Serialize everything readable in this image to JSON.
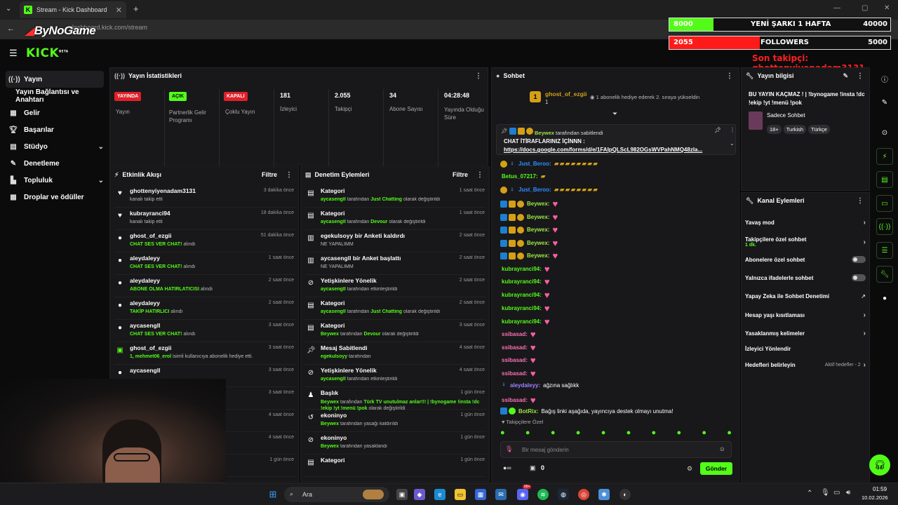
{
  "browser": {
    "tab_title": "Stream - Kick Dashboard",
    "url": "dashboard.kick.com/stream",
    "brand_overlay": "ByNoGame"
  },
  "overlay": {
    "goal1": {
      "current": "8000",
      "label": "YENİ ŞARKI 1 HAFTA",
      "target": "40000",
      "progress": 0.2,
      "color": "#53fc18"
    },
    "goal2": {
      "current": "2055",
      "label": "FOLLOWERS",
      "target": "5000",
      "progress": 0.41,
      "color": "#ff1a1a"
    },
    "last_follower": "Son takipçi: ghottenyiyenadam3131"
  },
  "kick": {
    "logo": "KICK",
    "beta": "BETA"
  },
  "sidebar": {
    "items": [
      {
        "label": "Yayın",
        "icon": "broadcast-icon"
      },
      {
        "label": "Yayın Bağlantısı ve Anahtarı",
        "icon": ""
      },
      {
        "label": "Gelir",
        "icon": "income-icon"
      },
      {
        "label": "Başarılar",
        "icon": "trophy-icon"
      },
      {
        "label": "Stüdyo",
        "icon": "studio-icon"
      },
      {
        "label": "Denetleme",
        "icon": "moderation-icon"
      },
      {
        "label": "Topluluk",
        "icon": "community-icon"
      },
      {
        "label": "Droplar ve ödüller",
        "icon": "drops-icon"
      }
    ]
  },
  "stats": {
    "title": "Yayın İstatistikleri",
    "cells": [
      {
        "badge": "YAYINDA",
        "badge_color": "#e0202a",
        "label": "Yayın"
      },
      {
        "badge": "AÇIK",
        "badge_color": "#53fc18",
        "label": "Partnerlik Gelir Programı"
      },
      {
        "badge": "KAPALI",
        "badge_color": "#e0202a",
        "label": "Çoklu Yayın"
      },
      {
        "value": "181",
        "label": "İzleyici"
      },
      {
        "value": "2.055",
        "label": "Takipçi"
      },
      {
        "value": "34",
        "label": "Abone Sayısı"
      },
      {
        "value": "04:28:48",
        "label": "Yayında Olduğu Süre"
      }
    ]
  },
  "activity": {
    "title": "Etkinlik Akışı",
    "filter": "Filtre",
    "rows": [
      {
        "name": "ghottenyiyenadam3131",
        "desc": "kanalı takip etti",
        "hl": "",
        "time": "3 dakika önce",
        "icon": "heart-icon"
      },
      {
        "name": "kubrayranci94",
        "desc": "kanalı takip etti",
        "hl": "",
        "time": "18 dakika önce",
        "icon": "heart-icon"
      },
      {
        "name": "ghost_of_ezgii",
        "hl": "CHAT SES VER CHAT!",
        "desc": "alındı",
        "time": "51 dakika önce",
        "icon": "points-icon"
      },
      {
        "name": "aleydaleyy",
        "hl": "CHAT SES VER CHAT!",
        "desc": "alındı",
        "time": "1 saat önce",
        "icon": "points-icon"
      },
      {
        "name": "aleydaleyy",
        "hl": "ABONE OLMA HATIRLATICISI",
        "desc": "alındı",
        "time": "2 saat önce",
        "icon": "points-icon"
      },
      {
        "name": "aleydaleyy",
        "hl": "TAKİP HATIRLICI",
        "desc": "alındı",
        "time": "2 saat önce",
        "icon": "points-icon"
      },
      {
        "name": "aycasengll",
        "hl": "CHAT SES VER CHAT!",
        "desc": "alındı",
        "time": "3 saat önce",
        "icon": "points-icon"
      },
      {
        "name": "ghost_of_ezgii",
        "hl": "1, mehmet06_erol",
        "desc": "isimli kullanıcıya abonelik hediye etti.",
        "time": "3 saat önce",
        "icon": "gift-icon"
      },
      {
        "name": "aycasengll",
        "hl": "",
        "desc": "",
        "time": "3 saat önce",
        "icon": "points-icon"
      },
      {
        "name": "",
        "hl": "",
        "desc": "",
        "time": "3 saat önce",
        "icon": ""
      },
      {
        "name": "",
        "hl": "",
        "desc": "",
        "time": "4 saat önce",
        "icon": ""
      },
      {
        "name": "",
        "hl": "",
        "desc": "",
        "time": "4 saat önce",
        "icon": ""
      },
      {
        "name": "",
        "hl": "",
        "desc": "",
        "time": "1 gün önce",
        "icon": ""
      }
    ]
  },
  "moderation": {
    "title": "Denetim Eylemleri",
    "filter": "Filtre",
    "rows": [
      {
        "name": "Kategori",
        "user": "aycasengll",
        "mid": "tarafından",
        "hl": "Just Chatting",
        "desc": "olarak değiştirildi",
        "time": "1 saat önce",
        "icon": "category-icon"
      },
      {
        "name": "Kategori",
        "user": "aycasengll",
        "mid": "tarafından",
        "hl": "Devour",
        "desc": "olarak değiştirildi",
        "time": "1 saat önce",
        "icon": "category-icon"
      },
      {
        "name": "egekulsoyy bir Anketi kaldırdı",
        "user": "",
        "mid": "NE YAPALIMM",
        "hl": "",
        "desc": "",
        "time": "2 saat önce",
        "icon": "poll-icon"
      },
      {
        "name": "aycasengll bir Anket başlattı",
        "user": "",
        "mid": "NE YAPALIMM",
        "hl": "",
        "desc": "",
        "time": "2 saat önce",
        "icon": "poll-icon"
      },
      {
        "name": "Yetişkinlere Yönelik",
        "user": "aycasengll",
        "mid": "tarafından etkinleştirildi",
        "hl": "",
        "desc": "",
        "time": "2 saat önce",
        "icon": "eye-off-icon"
      },
      {
        "name": "Kategori",
        "user": "aycasengll",
        "mid": "tarafından",
        "hl": "Just Chatting",
        "desc": "olarak değiştirildi",
        "time": "2 saat önce",
        "icon": "category-icon"
      },
      {
        "name": "Kategori",
        "user": "Beywex",
        "mid": "tarafından",
        "hl": "Devour",
        "desc": "olarak değiştirildi",
        "time": "3 saat önce",
        "icon": "category-icon"
      },
      {
        "name": "Mesaj Sabitlendi",
        "user": "egekulsoyy",
        "mid": "tarafından",
        "hl": "",
        "desc": "",
        "time": "4 saat önce",
        "icon": "pin-icon"
      },
      {
        "name": "Yetişkinlere Yönelik",
        "user": "aycasengll",
        "mid": "tarafından etkinleştirildi",
        "hl": "",
        "desc": "",
        "time": "4 saat önce",
        "icon": "eye-off-icon"
      },
      {
        "name": "Başlık",
        "user": "Beywex",
        "mid": "tarafından",
        "hl": "Türk TV unutulmaz anlar!!! | !bynogame !insta !dc !ekip !yt !menü !pok",
        "desc": "olarak değiştirildi",
        "time": "1 gün önce",
        "icon": "title-icon"
      },
      {
        "name": "ekoninyo",
        "user": "Beywex",
        "mid": "tarafından yasağı kaldırıldı",
        "hl": "",
        "desc": "",
        "time": "1 gün önce",
        "icon": "unban-icon"
      },
      {
        "name": "ekoninyo",
        "user": "Beywex",
        "mid": "tarafından yasaklandı",
        "hl": "",
        "desc": "",
        "time": "1 gün önce",
        "icon": "ban-icon"
      },
      {
        "name": "Kategori",
        "user": "",
        "mid": "",
        "hl": "",
        "desc": "",
        "time": "1 gün önce",
        "icon": "category-icon"
      }
    ]
  },
  "chat": {
    "title": "Sohbet",
    "top_gifter": {
      "name": "ghost_of_ezgii",
      "count": "1",
      "rank": "1",
      "note": "1 abonelik hediye ederek 2. sıraya yükseldin"
    },
    "pinned": {
      "by": "Beywex",
      "by_text": "tarafından sabitlendi",
      "line1": "CHAT İTİRAFLARINIZ İÇİNNN :",
      "line2": "https://docs.google.com/forms/d/e/1FAIpQLScL982OGsWVPahNMQ48zla..."
    },
    "messages": [
      {
        "user": "Just_Beroo:",
        "cls": "u-blue",
        "badges": "sub-drop",
        "content": "emotes",
        "text": "▰▰▰▰▰▰▰▰"
      },
      {
        "user": "Betus_07217:",
        "cls": "u-green",
        "badges": "",
        "content": "emotes",
        "text": "▰"
      },
      {
        "user": "Just_Beroo:",
        "cls": "u-blue",
        "badges": "sub-drop",
        "content": "emotes",
        "text": "▰▰▰▰▰▰▰▰"
      },
      {
        "user": "Beywex:",
        "cls": "u-lime",
        "badges": "mod",
        "content": "heart",
        "text": "♥"
      },
      {
        "user": "Beywex:",
        "cls": "u-lime",
        "badges": "mod",
        "content": "heart",
        "text": "♥"
      },
      {
        "user": "Beywex:",
        "cls": "u-lime",
        "badges": "mod",
        "content": "heart",
        "text": "♥"
      },
      {
        "user": "Beywex:",
        "cls": "u-lime",
        "badges": "mod",
        "content": "heart",
        "text": "♥"
      },
      {
        "user": "Beywex:",
        "cls": "u-lime",
        "badges": "mod",
        "content": "heart",
        "text": "♥"
      },
      {
        "user": "kubrayranci94:",
        "cls": "u-green",
        "badges": "",
        "content": "heart",
        "text": "♥"
      },
      {
        "user": "kubrayranci94:",
        "cls": "u-green",
        "badges": "",
        "content": "heart",
        "text": "♥"
      },
      {
        "user": "kubrayranci94:",
        "cls": "u-green",
        "badges": "",
        "content": "heart",
        "text": "♥"
      },
      {
        "user": "kubrayranci94:",
        "cls": "u-green",
        "badges": "",
        "content": "heart",
        "text": "♥"
      },
      {
        "user": "kubrayranci94:",
        "cls": "u-green",
        "badges": "",
        "content": "heart",
        "text": "♥"
      },
      {
        "user": "ssibasad:",
        "cls": "u-pink",
        "badges": "",
        "content": "heart",
        "text": "♥"
      },
      {
        "user": "ssibasad:",
        "cls": "u-pink",
        "badges": "",
        "content": "heart",
        "text": "♥"
      },
      {
        "user": "ssibasad:",
        "cls": "u-pink",
        "badges": "",
        "content": "heart",
        "text": "♥"
      },
      {
        "user": "ssibasad:",
        "cls": "u-pink",
        "badges": "",
        "content": "heart",
        "text": "♥"
      },
      {
        "user": "aleydaleyy:",
        "cls": "u-purple",
        "badges": "drop",
        "content": "text",
        "text": "ağzına sağlıkk"
      },
      {
        "user": "ssibasad:",
        "cls": "u-pink",
        "badges": "",
        "content": "heart",
        "text": "♥"
      },
      {
        "user": "BotRix:",
        "cls": "u-lime",
        "badges": "bot",
        "content": "text",
        "text": "Bağış linki aşağıda, yayıncıya destek olmayı unutma!"
      }
    ],
    "followers_only": "Takipçilere Özel",
    "input_placeholder": "Bir mesaj gönderin",
    "points": "0",
    "send_label": "Gönder"
  },
  "stream_info": {
    "title": "Yayın bilgisi",
    "stream_title": "BU YAYIN KAÇMAZ ! | !bynogame !insta !dc !ekip !yt !menü !pok",
    "category": "Sadece Sohbet",
    "tags": [
      "18+",
      "Turkish",
      "Türkçe"
    ]
  },
  "channel_actions": {
    "title": "Kanal Eylemleri",
    "items": [
      {
        "label": "Yavaş mod",
        "type": "chevron"
      },
      {
        "label": "Takipçilere özel sohbet",
        "sub": "1 dk.",
        "type": "chevron"
      },
      {
        "label": "Abonelere özel sohbet",
        "type": "toggle"
      },
      {
        "label": "Yalnızca ifadelerle sohbet",
        "type": "toggle"
      },
      {
        "label": "Yapay Zeka ile Sohbet Denetimi",
        "type": "external"
      },
      {
        "label": "Hesap yaşı kısıtlaması",
        "type": "chevron"
      },
      {
        "label": "Yasaklanmış kelimeler",
        "type": "chevron"
      },
      {
        "label": "İzleyici Yönlendir",
        "type": "none"
      },
      {
        "label": "Hedefleri belirleyin",
        "sub": "Aktif hedefler - 2",
        "type": "chevron"
      }
    ]
  },
  "taskbar": {
    "search": "Ara",
    "time": "01:59",
    "date": "10.02.2026",
    "notif_count": "99+"
  }
}
